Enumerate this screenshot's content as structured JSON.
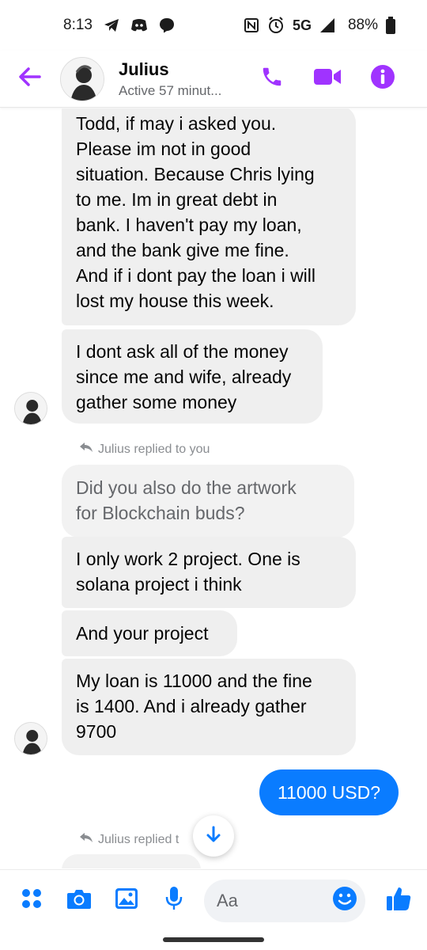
{
  "status_bar": {
    "time": "8:13",
    "network": "5G",
    "battery": "88%"
  },
  "header": {
    "contact_name": "Julius",
    "active_status": "Active 57 minut..."
  },
  "messages": [
    {
      "lines": [
        "Todd, if may i asked you.",
        "Please im not in good",
        "situation. Because Chris lying",
        "to me. Im in great debt in",
        "bank. I haven't pay my loan,",
        "and the bank give me fine.",
        "And if i dont pay the loan i will",
        "lost my house this week."
      ]
    },
    {
      "lines": [
        "I dont ask all of the money",
        "since me and wife, already",
        "gather some money"
      ]
    },
    {
      "reply_note": "Julius replied to you"
    },
    {
      "quoted_lines": [
        "Did you also do the artwork",
        "for Blockchain buds?"
      ]
    },
    {
      "lines": [
        "I only work 2 project. One is",
        "solana project i think"
      ]
    },
    {
      "lines": [
        "And your project"
      ]
    },
    {
      "lines": [
        "My loan is 11000 and the fine",
        "is 1400. And i already gather",
        "9700"
      ]
    },
    {
      "own_text": "11000 USD?"
    },
    {
      "reply_note": "Julius replied t"
    }
  ],
  "composer": {
    "placeholder": "Aa"
  },
  "colors": {
    "accent_purple": "#a033ff",
    "messenger_blue": "#0a7cff",
    "bubble_gray": "#efefef"
  }
}
